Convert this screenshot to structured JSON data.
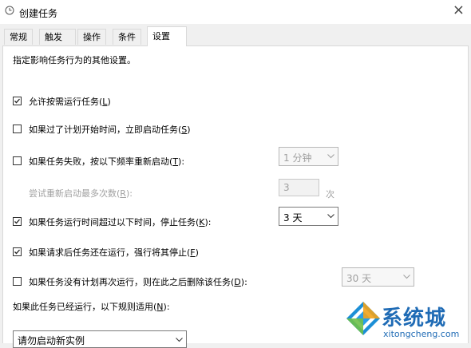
{
  "window": {
    "title": "创建任务",
    "close_glyph": "×"
  },
  "tabs": [
    {
      "label": "常规"
    },
    {
      "label": "触发器"
    },
    {
      "label": "操作"
    },
    {
      "label": "条件"
    },
    {
      "label": "设置"
    }
  ],
  "settings": {
    "description": "指定影响任务行为的其他设置。",
    "allow_on_demand": {
      "text": "允许按需运行任务(",
      "key": "L",
      "tail": ")",
      "checked": true
    },
    "start_if_missed": {
      "text": "如果过了计划开始时间，立即启动任务(",
      "key": "S",
      "tail": ")",
      "checked": false
    },
    "restart_if_fails": {
      "text": "如果任务失败，按以下频率重新启动(",
      "key": "T",
      "tail": "):",
      "checked": false,
      "interval": "1 分钟"
    },
    "restart_attempts": {
      "text": "尝试重新启动最多次数(",
      "key": "R",
      "tail": "):",
      "value": "3",
      "unit": "次"
    },
    "stop_if_runs_longer": {
      "text": "如果任务运行时间超过以下时间，停止任务(",
      "key": "K",
      "tail": "):",
      "checked": true,
      "duration": "3 天"
    },
    "force_stop": {
      "text": "如果请求后任务还在运行，强行将其停止(",
      "key": "F",
      "tail": ")",
      "checked": true
    },
    "delete_if_not_scheduled": {
      "text": "如果任务没有计划再次运行，则在此之后删除该任务(",
      "key": "D",
      "tail": "):",
      "checked": false,
      "after": "30 天"
    },
    "rule_label": {
      "text": "如果此任务已经运行，以下规则适用(",
      "key": "N",
      "tail": "):"
    },
    "rule_value": "请勿启动新实例"
  },
  "watermark": {
    "brand": "系统城",
    "url": "xitongcheng.com"
  }
}
